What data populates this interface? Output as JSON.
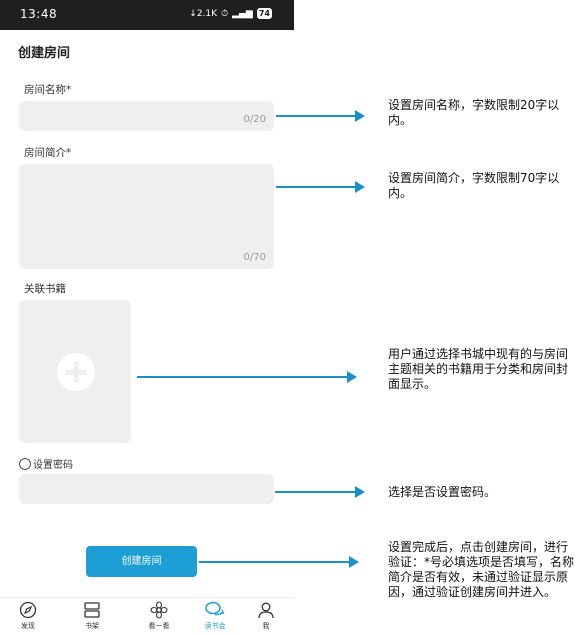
{
  "status_bar": {
    "time": "13:48",
    "indicators": "↓2.1K ⏱ ᴴᴰ.▍",
    "battery": "74"
  },
  "page": {
    "title": "创建房间"
  },
  "form": {
    "room_name": {
      "label": "房间名称*",
      "value": "",
      "counter": "0/20"
    },
    "room_intro": {
      "label": "房间简介*",
      "value": "",
      "counter": "0/70"
    },
    "related_books": {
      "label": "关联书籍"
    },
    "password": {
      "label": "设置密码",
      "checked": false,
      "value": ""
    },
    "create_button": "创建房间"
  },
  "tab_bar": {
    "active": "读书会",
    "items": [
      {
        "label": "发现",
        "icon": "compass-icon"
      },
      {
        "label": "书架",
        "icon": "bookshelf-icon"
      },
      {
        "label": "看一看",
        "icon": "flower-icon"
      },
      {
        "label": "读书会",
        "icon": "chat-bubbles-icon"
      },
      {
        "label": "我",
        "icon": "person-icon"
      }
    ]
  },
  "annotations": [
    "设置房间名称，字数限制20字以内。",
    "设置房间简介，字数限制70字以内。",
    "用户通过选择书城中现有的与房间主题相关的书籍用于分类和房间封面显示。",
    "选择是否设置密码。",
    "设置完成后，点击创建房间，进行验证：*号必填选项是否填写，名称简介是否有效，未通过验证显示原因，通过验证创建房间并进入。"
  ],
  "colors": {
    "accent": "#1d9fd6",
    "arrow": "#1b8fc7",
    "input_bg": "#efefef",
    "status_bar": "#1f1f1f"
  }
}
